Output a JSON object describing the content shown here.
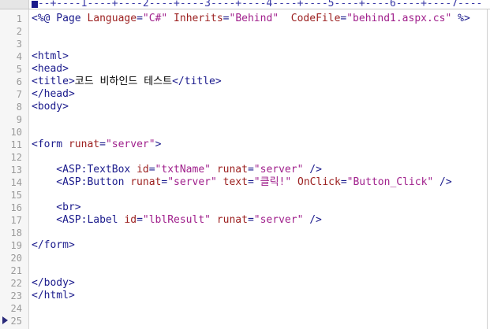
{
  "ruler": {
    "text": "---+----1----+----2----+----3----+----4----+----5----+----6----+----7----"
  },
  "line_numbers": [
    "1",
    "2",
    "3",
    "4",
    "5",
    "6",
    "7",
    "8",
    "9",
    "10",
    "11",
    "12",
    "13",
    "14",
    "15",
    "16",
    "17",
    "18",
    "19",
    "20",
    "21",
    "22",
    "23",
    "24",
    "25"
  ],
  "code": {
    "line1": {
      "open": "<%@ Page ",
      "a1": "Language",
      "eq1": "=",
      "v1": "\"C#\"",
      "a2": " Inherits",
      "eq2": "=",
      "v2": "\"Behind\"",
      "a3": "  CodeFile",
      "eq3": "=",
      "v3": "\"behind1.aspx.cs\"",
      "close": " %>"
    },
    "line4": "<html>",
    "line5": "<head>",
    "line6": {
      "open": "<title>",
      "text": "코드 비하인드 테스트",
      "close": "</title>"
    },
    "line7": "</head>",
    "line8": "<body>",
    "line11": {
      "open": "<form ",
      "a1": "runat",
      "eq1": "=",
      "v1": "\"server\"",
      "close": ">"
    },
    "line13": {
      "open": "    <ASP:TextBox ",
      "a1": "id",
      "eq1": "=",
      "v1": "\"txtName\"",
      "a2": " runat",
      "eq2": "=",
      "v2": "\"server\"",
      "close": " />"
    },
    "line14": {
      "open": "    <ASP:Button ",
      "a1": "runat",
      "eq1": "=",
      "v1": "\"server\"",
      "a2": " text",
      "eq2": "=",
      "v2": "\"클릭!\"",
      "a3": " OnClick",
      "eq3": "=",
      "v3": "\"Button_Click\"",
      "close": " />"
    },
    "line16": "    <br>",
    "line17": {
      "open": "    <ASP:Label ",
      "a1": "id",
      "eq1": "=",
      "v1": "\"lblResult\"",
      "a2": " runat",
      "eq2": "=",
      "v2": "\"server\"",
      "close": " />"
    },
    "line19": "</form>",
    "line22": "</body>",
    "line23": "</html>"
  },
  "colors": {
    "tag": "#1a1a8c",
    "attribute": "#9b1e1e",
    "value": "#a0208c",
    "text": "#000000"
  }
}
